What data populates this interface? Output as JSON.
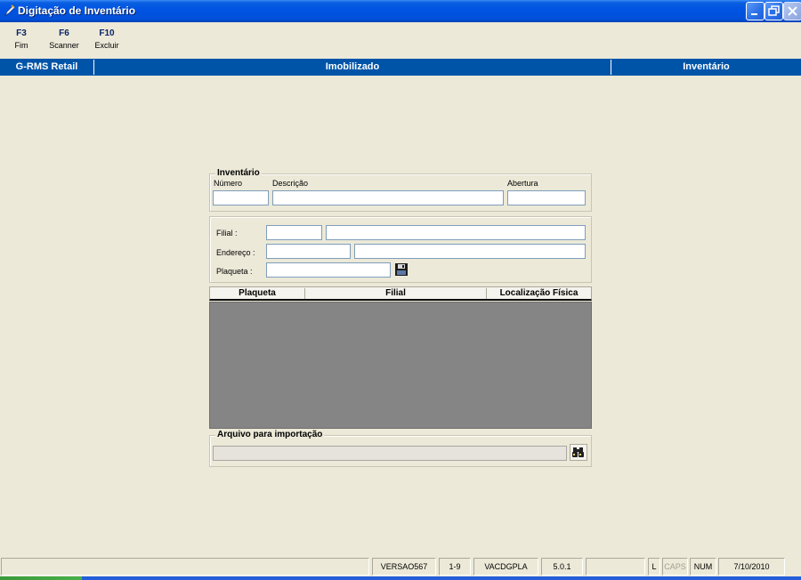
{
  "window": {
    "title": "Digitação de Inventário",
    "app_icon": "pen-icon",
    "controls": [
      "minimize-icon",
      "restore-icon",
      "close-icon"
    ]
  },
  "toolbar": {
    "items": [
      {
        "key": "F3",
        "label": "Fim"
      },
      {
        "key": "F6",
        "label": "Scanner"
      },
      {
        "key": "F10",
        "label": "Excluir"
      }
    ]
  },
  "header": {
    "left": "G-RMS Retail",
    "center": "Imobilizado",
    "right": "Inventário"
  },
  "inventario": {
    "group_title": "Inventário",
    "numero_label": "Número",
    "numero_value": "",
    "descricao_label": "Descrição",
    "descricao_value": "",
    "abertura_label": "Abertura",
    "abertura_value": ""
  },
  "details": {
    "filial_label": "Filial :",
    "filial_code": "",
    "filial_name": "",
    "endereco_label": "Endereço :",
    "endereco_code": "",
    "endereco_desc": "",
    "plaqueta_label": "Plaqueta :",
    "plaqueta_value": "",
    "save_icon": "floppy-disk-icon"
  },
  "grid": {
    "columns": [
      "Plaqueta",
      "Filial",
      "Localização Física"
    ],
    "rows": []
  },
  "importacao": {
    "group_title": "Arquivo para importação",
    "file_value": "",
    "browse_icon": "binoculars-icon"
  },
  "statusbar": {
    "cells": [
      "",
      "VERSAO567",
      "1-9",
      "VACDGPLA",
      "5.0.1",
      "",
      "L",
      "CAPS",
      "NUM",
      "7/10/2010"
    ]
  },
  "colors": {
    "title_bar": "#0054e3",
    "header_band": "#0054a8",
    "window_bg": "#ece9d8",
    "grid_body": "#858585",
    "field_border": "#7f9db9"
  }
}
